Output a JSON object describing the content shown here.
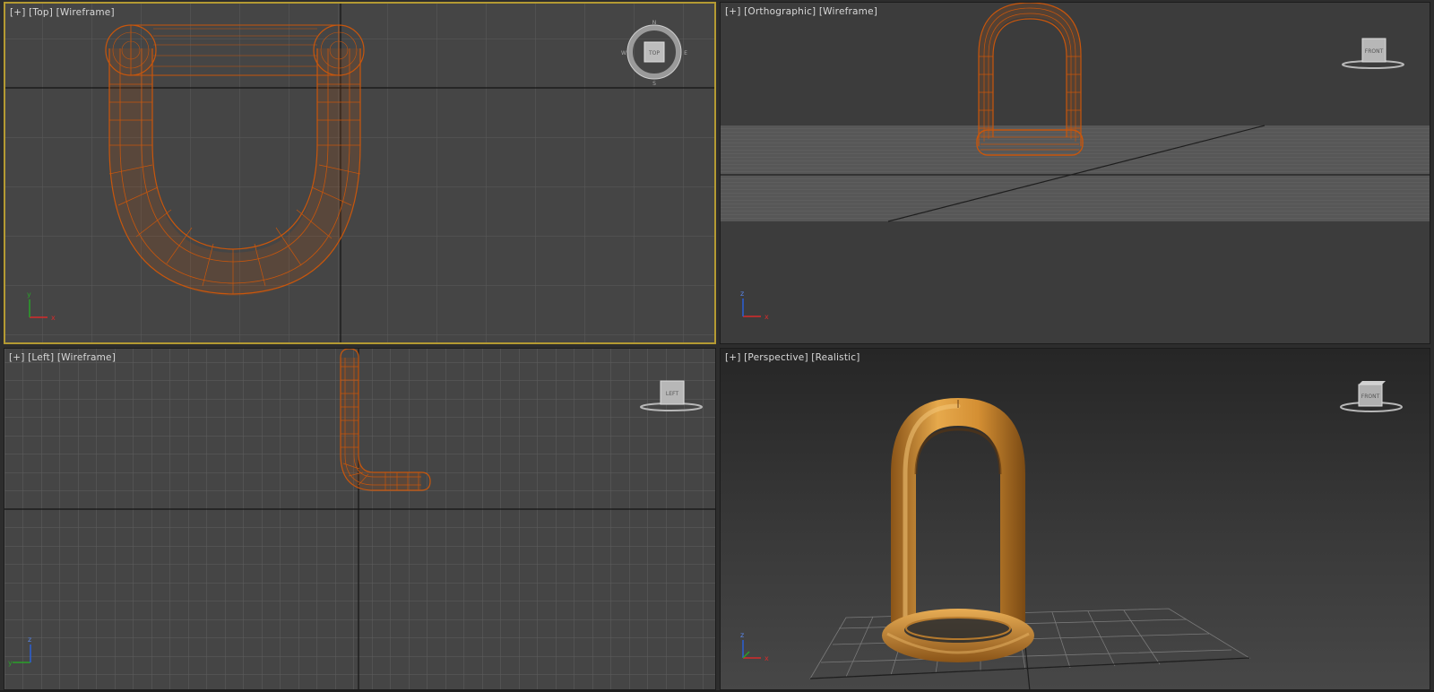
{
  "viewports": {
    "top": {
      "menu": "[+]",
      "view": "[Top]",
      "shading": "[Wireframe]",
      "cube_label": "TOP",
      "compass": [
        "N",
        "E",
        "S",
        "W"
      ]
    },
    "front": {
      "menu": "[+]",
      "view": "[Orthographic]",
      "shading": "[Wireframe]",
      "cube_label": "FRONT"
    },
    "left": {
      "menu": "[+]",
      "view": "[Left]",
      "shading": "[Wireframe]",
      "cube_label": "LEFT"
    },
    "perspective": {
      "menu": "[+]",
      "view": "[Perspective]",
      "shading": "[Realistic]",
      "cube_label": "FRONT"
    }
  },
  "axis_labels": {
    "x": "x",
    "y": "y",
    "z": "z"
  },
  "colors": {
    "wire": "#c8560c",
    "shaded": "#d79236",
    "active_border": "#b49a33",
    "grid": "#5a5a5a",
    "axis_x": "#d62b2b",
    "axis_y": "#2aa02a",
    "axis_z": "#2b5fd6"
  }
}
